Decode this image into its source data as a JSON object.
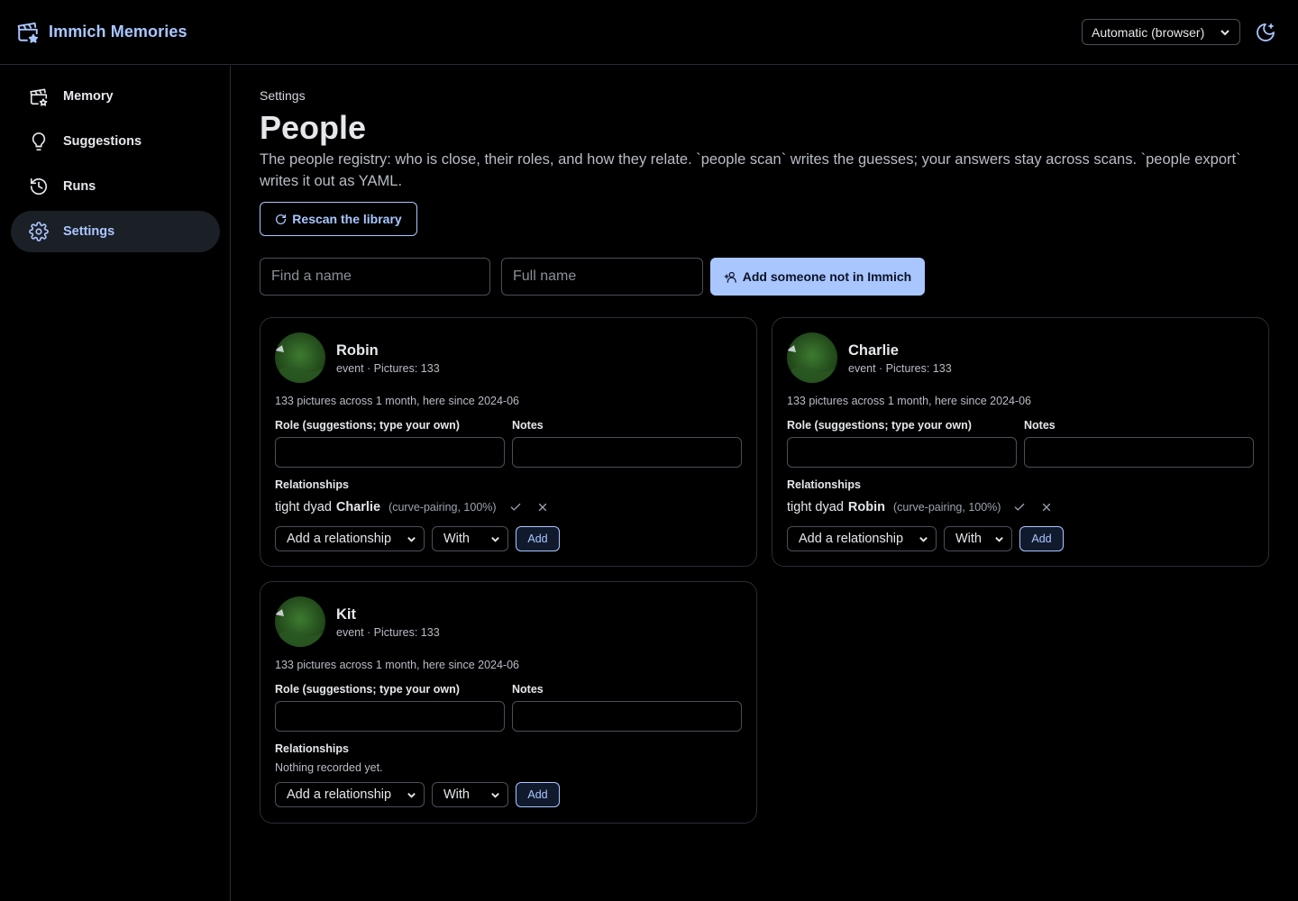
{
  "app": {
    "title": "Immich Memories"
  },
  "header": {
    "theme_select": "Automatic (browser)"
  },
  "sidebar": {
    "items": [
      {
        "label": "Memory",
        "icon": "clapperboard-icon"
      },
      {
        "label": "Suggestions",
        "icon": "lightbulb-icon"
      },
      {
        "label": "Runs",
        "icon": "history-icon"
      },
      {
        "label": "Settings",
        "icon": "gear-icon",
        "active": true
      }
    ]
  },
  "page": {
    "breadcrumb": "Settings",
    "title": "People",
    "description": "The people registry: who is close, their roles, and how they relate. `people scan` writes the guesses; your answers stay across scans. `people export` writes it out as YAML.",
    "rescan_label": "Rescan the library",
    "find_placeholder": "Find a name",
    "fullname_placeholder": "Full name",
    "add_label": "Add someone not in Immich"
  },
  "labels": {
    "role": "Role (suggestions; type your own)",
    "notes": "Notes",
    "relationships": "Relationships",
    "add_relationship": "Add a relationship",
    "with": "With",
    "add": "Add",
    "nothing": "Nothing recorded yet."
  },
  "people": [
    {
      "name": "Robin",
      "meta": "event · Pictures: 133",
      "summary": "133 pictures across 1 month, here since 2024-06",
      "relationship": {
        "type": "tight dyad",
        "person": "Charlie",
        "source": "(curve-pairing, 100%)"
      }
    },
    {
      "name": "Charlie",
      "meta": "event · Pictures: 133",
      "summary": "133 pictures across 1 month, here since 2024-06",
      "relationship": {
        "type": "tight dyad",
        "person": "Robin",
        "source": "(curve-pairing, 100%)"
      }
    },
    {
      "name": "Kit",
      "meta": "event · Pictures: 133",
      "summary": "133 pictures across 1 month, here since 2024-06"
    }
  ],
  "colors": {
    "accent": "#a9c6ff",
    "background": "#000000",
    "border": "#2a2d33"
  }
}
